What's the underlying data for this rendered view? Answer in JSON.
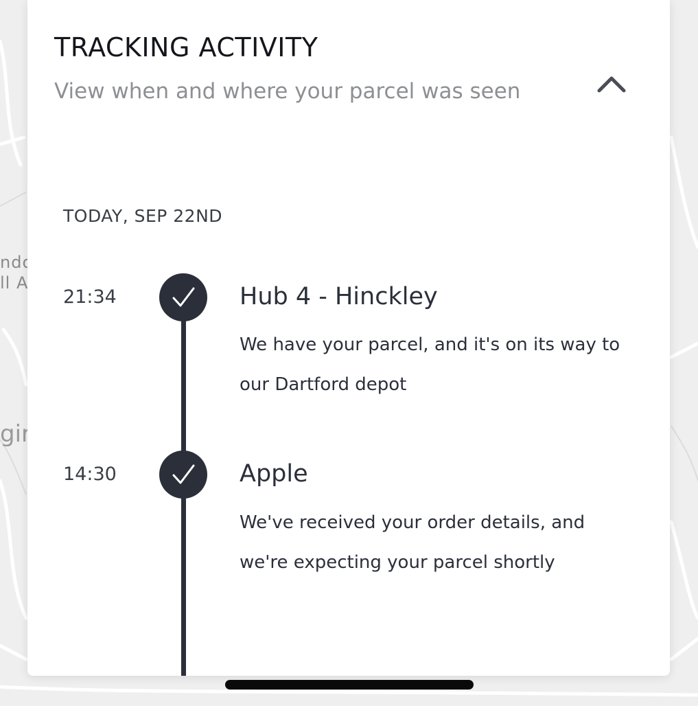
{
  "map": {
    "label_1": "ndor",
    "label_2": "ll A",
    "label_3": "gir"
  },
  "tracking": {
    "title": "TRACKING ACTIVITY",
    "subtitle": "View when and where your parcel was seen",
    "collapse_icon": "chevron-up-icon",
    "date_heading": "TODAY, SEP 22ND",
    "events": [
      {
        "time": "21:34",
        "status_icon": "check-icon",
        "location": "Hub 4 - Hinckley",
        "description": "We have your parcel, and it's on its way to our Dartford depot"
      },
      {
        "time": "14:30",
        "status_icon": "check-icon",
        "location": "Apple",
        "description": "We've received your order details, and we're expecting your parcel shortly"
      }
    ]
  },
  "colors": {
    "timeline": "#2b2f3a",
    "title": "#14161c",
    "subtitle": "#8d8f93",
    "card_background": "#ffffff",
    "map_background": "#efefef"
  }
}
